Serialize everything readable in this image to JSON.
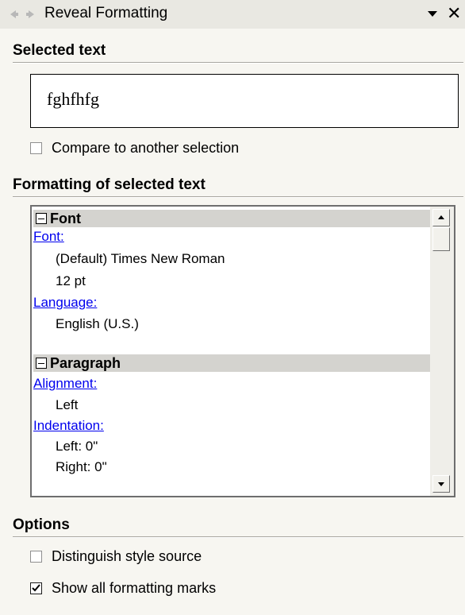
{
  "titlebar": {
    "back_icon": "back-arrow-icon",
    "forward_icon": "forward-arrow-icon",
    "title": "Reveal Formatting",
    "dropdown_icon": "dropdown-triangle-icon",
    "close_label": "✕"
  },
  "selected": {
    "heading": "Selected text",
    "text": "fghfhfg",
    "compare_label": "Compare to another selection",
    "compare_checked": false
  },
  "formatting": {
    "heading": "Formatting of selected text",
    "groups": [
      {
        "title": "Font",
        "items": [
          {
            "label": "Font:",
            "values": [
              "(Default) Times New Roman",
              "12 pt"
            ]
          },
          {
            "label": "Language:",
            "values": [
              "English (U.S.)"
            ]
          }
        ]
      },
      {
        "title": "Paragraph",
        "items": [
          {
            "label": "Alignment:",
            "values": [
              "Left"
            ]
          },
          {
            "label": "Indentation:",
            "values": [
              "Left:  0\"",
              "Right:  0\""
            ]
          }
        ]
      }
    ]
  },
  "options": {
    "heading": "Options",
    "distinguish_label": "Distinguish style source",
    "distinguish_checked": false,
    "show_marks_label": "Show all formatting marks",
    "show_marks_checked": true
  },
  "colors": {
    "link": "#0000ee",
    "group_header_bg": "#d4d3cf",
    "panel_bg": "#f7f6f1"
  }
}
